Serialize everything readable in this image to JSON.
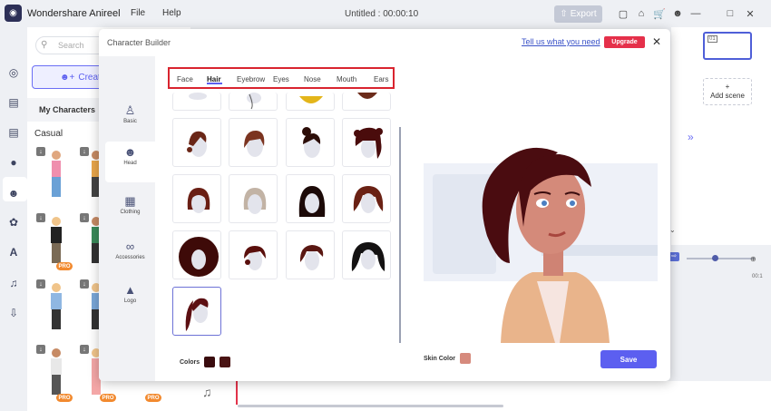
{
  "app": {
    "name": "Wondershare Anireel",
    "menu": [
      "File",
      "Help"
    ],
    "document_title": "Untitled : 00:00:10",
    "export_label": "Export"
  },
  "sidebar_panel": {
    "search_placeholder": "Search",
    "create_label": "Create",
    "my_characters_tab": "My Characters",
    "category": "Casual",
    "pro_badge": "PRO"
  },
  "scenes": {
    "scene_number": "01",
    "add_scene_label": "Add scene",
    "timeline_time": "00:1"
  },
  "modal": {
    "title": "Character Builder",
    "feedback_link": "Tell us what you need",
    "upgrade_label": "Upgrade",
    "side_nav": [
      {
        "label": "Basic",
        "icon": "person-icon"
      },
      {
        "label": "Head",
        "icon": "head-icon",
        "active": true
      },
      {
        "label": "Clothing",
        "icon": "shirt-icon"
      },
      {
        "label": "Accessories",
        "icon": "glasses-icon"
      },
      {
        "label": "Logo",
        "icon": "shapes-icon"
      }
    ],
    "tabs": [
      "Face",
      "Hair",
      "Eyebrow",
      "Eyes",
      "Nose",
      "Mouth",
      "Ears"
    ],
    "active_tab": "Hair",
    "colors_label": "Colors",
    "hair_colors": [
      "#3a0c0e",
      "#4a1414"
    ],
    "skin_color_label": "Skin Color",
    "skin_color": "#d68a7d",
    "save_label": "Save"
  },
  "colors": {
    "accent": "#5c5ff0",
    "upgrade": "#e5304a",
    "highlight_box": "#d9242f"
  }
}
